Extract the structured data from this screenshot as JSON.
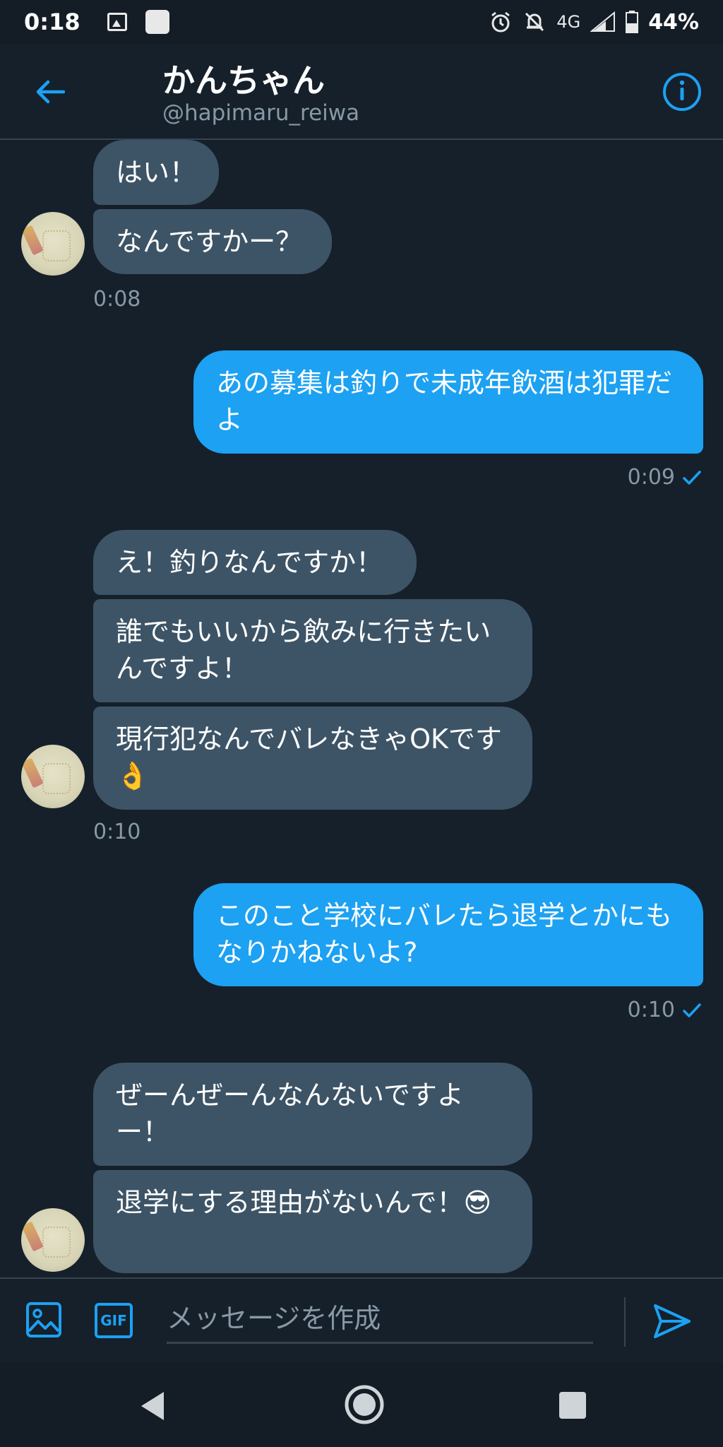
{
  "status_bar": {
    "time": "0:18",
    "network": "4G",
    "battery": "44%"
  },
  "header": {
    "title": "かんちゃん",
    "handle": "@hapimaru_reiwa"
  },
  "messages": {
    "m1": "はい！",
    "m2": "なんですかー？",
    "t1": "0:08",
    "m3": "あの募集は釣りで未成年飲酒は犯罪だよ",
    "t2": "0:09",
    "m4": "え！釣りなんですか！",
    "m5": "誰でもいいから飲みに行きたいんですよ！",
    "m6": "現行犯なんでバレなきゃOKです👌",
    "t3": "0:10",
    "m7": "このこと学校にバレたら退学とかにもなりかねないよ?",
    "t4": "0:10",
    "m8": "ぜーんぜーんなんないですよー！",
    "m9": "退学にする理由がないんで！😎"
  },
  "composer": {
    "gif_label": "GIF",
    "placeholder": "メッセージを作成"
  },
  "colors": {
    "background": "#15202b",
    "accent": "#1da1f2",
    "incoming_bubble": "#3d5466",
    "secondary_text": "#8899a6"
  }
}
